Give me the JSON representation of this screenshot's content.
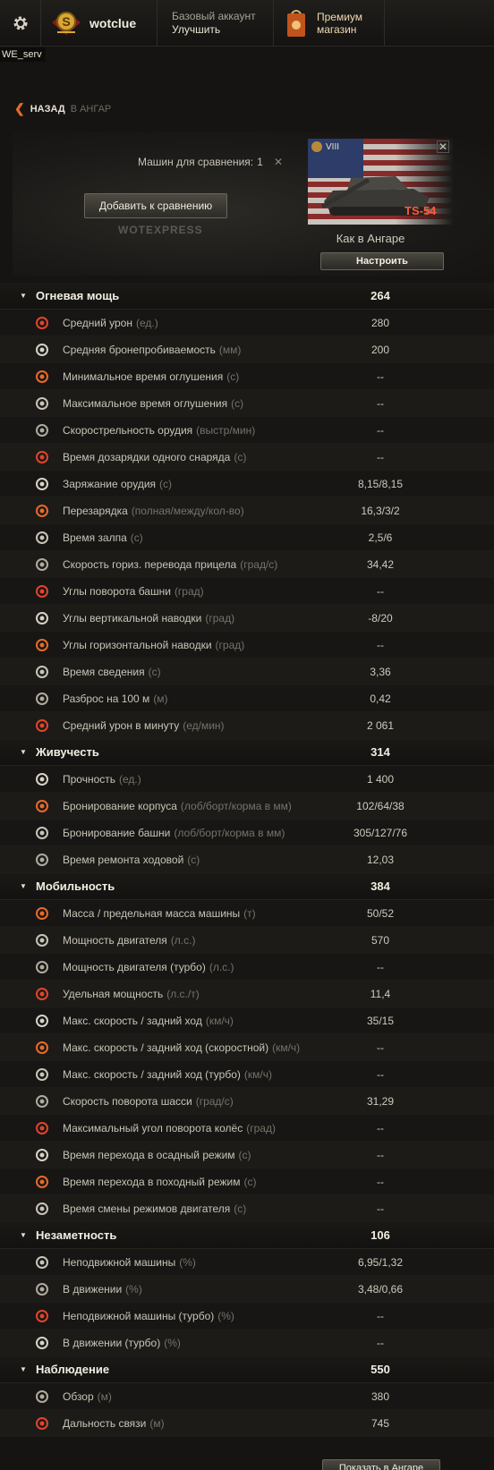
{
  "header": {
    "username": "wotclue",
    "account_type": "Базовый аккаунт",
    "upgrade_label": "Улучшить",
    "premium_line1": "Премиум",
    "premium_line2": "магазин",
    "server": "WE_serv"
  },
  "nav": {
    "back_label": "НАЗАД",
    "back_target": "В АНГАР"
  },
  "compare": {
    "count_label": "Машин для сравнения:",
    "count_value": "1",
    "add_button": "Добавить к сравнению",
    "brand": "WOTEXPRESS"
  },
  "tank": {
    "tier": "VIII",
    "name": "TS-54",
    "state": "Как в Ангаре",
    "configure_button": "Настроить"
  },
  "categories": [
    {
      "name": "Огневая мощь",
      "score": "264",
      "stats": [
        {
          "icon": "avg-damage-icon",
          "name": "Средний урон",
          "unit": "(ед.)",
          "value": "280"
        },
        {
          "icon": "penetration-icon",
          "name": "Средняя бронепробиваемость",
          "unit": "(мм)",
          "value": "200"
        },
        {
          "icon": "stun-min-icon",
          "name": "Минимальное время оглушения",
          "unit": "(с)",
          "value": "--"
        },
        {
          "icon": "stun-max-icon",
          "name": "Максимальное время оглушения",
          "unit": "(с)",
          "value": "--"
        },
        {
          "icon": "rate-of-fire-icon",
          "name": "Скорострельность орудия",
          "unit": "(выстр/мин)",
          "value": "--"
        },
        {
          "icon": "shell-reload-icon",
          "name": "Время дозарядки одного снаряда",
          "unit": "(с)",
          "value": "--"
        },
        {
          "icon": "loading-icon",
          "name": "Заряжание орудия",
          "unit": "(с)",
          "value": "8,15/8,15"
        },
        {
          "icon": "magazine-reload-icon",
          "name": "Перезарядка",
          "unit": "(полная/между/кол-во)",
          "value": "16,3/3/2"
        },
        {
          "icon": "salvo-icon",
          "name": "Время залпа",
          "unit": "(с)",
          "value": "2,5/6"
        },
        {
          "icon": "traverse-speed-icon",
          "name": "Скорость гориз. перевода прицела",
          "unit": "(град/с)",
          "value": "34,42"
        },
        {
          "icon": "turret-rotation-icon",
          "name": "Углы поворота башни",
          "unit": "(град)",
          "value": "--"
        },
        {
          "icon": "elevation-icon",
          "name": "Углы вертикальной наводки",
          "unit": "(град)",
          "value": "-8/20"
        },
        {
          "icon": "horizontal-aim-icon",
          "name": "Углы горизонтальной наводки",
          "unit": "(град)",
          "value": "--"
        },
        {
          "icon": "aim-time-icon",
          "name": "Время сведения",
          "unit": "(с)",
          "value": "3,36"
        },
        {
          "icon": "dispersion-icon",
          "name": "Разброс на 100 м",
          "unit": "(м)",
          "value": "0,42"
        },
        {
          "icon": "dpm-icon",
          "name": "Средний урон в минуту",
          "unit": "(ед/мин)",
          "value": "2 061"
        }
      ]
    },
    {
      "name": "Живучесть",
      "score": "314",
      "stats": [
        {
          "icon": "hitpoints-icon",
          "name": "Прочность",
          "unit": "(ед.)",
          "value": "1 400"
        },
        {
          "icon": "hull-armor-icon",
          "name": "Бронирование корпуса",
          "unit": "(лоб/борт/корма в мм)",
          "value": "102/64/38"
        },
        {
          "icon": "turret-armor-icon",
          "name": "Бронирование башни",
          "unit": "(лоб/борт/корма в мм)",
          "value": "305/127/76"
        },
        {
          "icon": "repair-time-icon",
          "name": "Время ремонта ходовой",
          "unit": "(с)",
          "value": "12,03"
        }
      ]
    },
    {
      "name": "Мобильность",
      "score": "384",
      "stats": [
        {
          "icon": "weight-icon",
          "name": "Масса / предельная масса машины",
          "unit": "(т)",
          "value": "50/52"
        },
        {
          "icon": "engine-power-icon",
          "name": "Мощность двигателя",
          "unit": "(л.с.)",
          "value": "570"
        },
        {
          "icon": "engine-power-turbo-icon",
          "name": "Мощность двигателя (турбо)",
          "unit": "(л.с.)",
          "value": "--"
        },
        {
          "icon": "specific-power-icon",
          "name": "Удельная мощность",
          "unit": "(л.с./т)",
          "value": "11,4"
        },
        {
          "icon": "speed-limits-icon",
          "name": "Макс. скорость / задний ход",
          "unit": "(км/ч)",
          "value": "35/15"
        },
        {
          "icon": "speed-fast-icon",
          "name": "Макс. скорость / задний ход (скоростной)",
          "unit": "(км/ч)",
          "value": "--"
        },
        {
          "icon": "speed-turbo-icon",
          "name": "Макс. скорость / задний ход (турбо)",
          "unit": "(км/ч)",
          "value": "--"
        },
        {
          "icon": "chassis-rotation-icon",
          "name": "Скорость поворота шасси",
          "unit": "(град/с)",
          "value": "31,29"
        },
        {
          "icon": "wheel-angle-icon",
          "name": "Максимальный угол поворота колёс",
          "unit": "(град)",
          "value": "--"
        },
        {
          "icon": "siege-mode-icon",
          "name": "Время перехода в осадный режим",
          "unit": "(с)",
          "value": "--"
        },
        {
          "icon": "travel-mode-icon",
          "name": "Время перехода в походный режим",
          "unit": "(с)",
          "value": "--"
        },
        {
          "icon": "engine-mode-icon",
          "name": "Время смены режимов двигателя",
          "unit": "(с)",
          "value": "--"
        }
      ]
    },
    {
      "name": "Незаметность",
      "score": "106",
      "stats": [
        {
          "icon": "camo-still-icon",
          "name": "Неподвижной машины",
          "unit": "(%)",
          "value": "6,95/1,32"
        },
        {
          "icon": "camo-moving-icon",
          "name": "В движении",
          "unit": "(%)",
          "value": "3,48/0,66"
        },
        {
          "icon": "camo-still-turbo-icon",
          "name": "Неподвижной машины (турбо)",
          "unit": "(%)",
          "value": "--"
        },
        {
          "icon": "camo-moving-turbo-icon",
          "name": "В движении (турбо)",
          "unit": "(%)",
          "value": "--"
        }
      ]
    },
    {
      "name": "Наблюдение",
      "score": "550",
      "stats": [
        {
          "icon": "view-range-icon",
          "name": "Обзор",
          "unit": "(м)",
          "value": "380"
        },
        {
          "icon": "radio-range-icon",
          "name": "Дальность связи",
          "unit": "(м)",
          "value": "745"
        }
      ]
    }
  ],
  "footer": {
    "show_in_hangar": "Показать в Ангаре"
  },
  "colors": {
    "accent": "#e96a2a",
    "tank_name": "#ff5a3a",
    "background": "#151412"
  }
}
